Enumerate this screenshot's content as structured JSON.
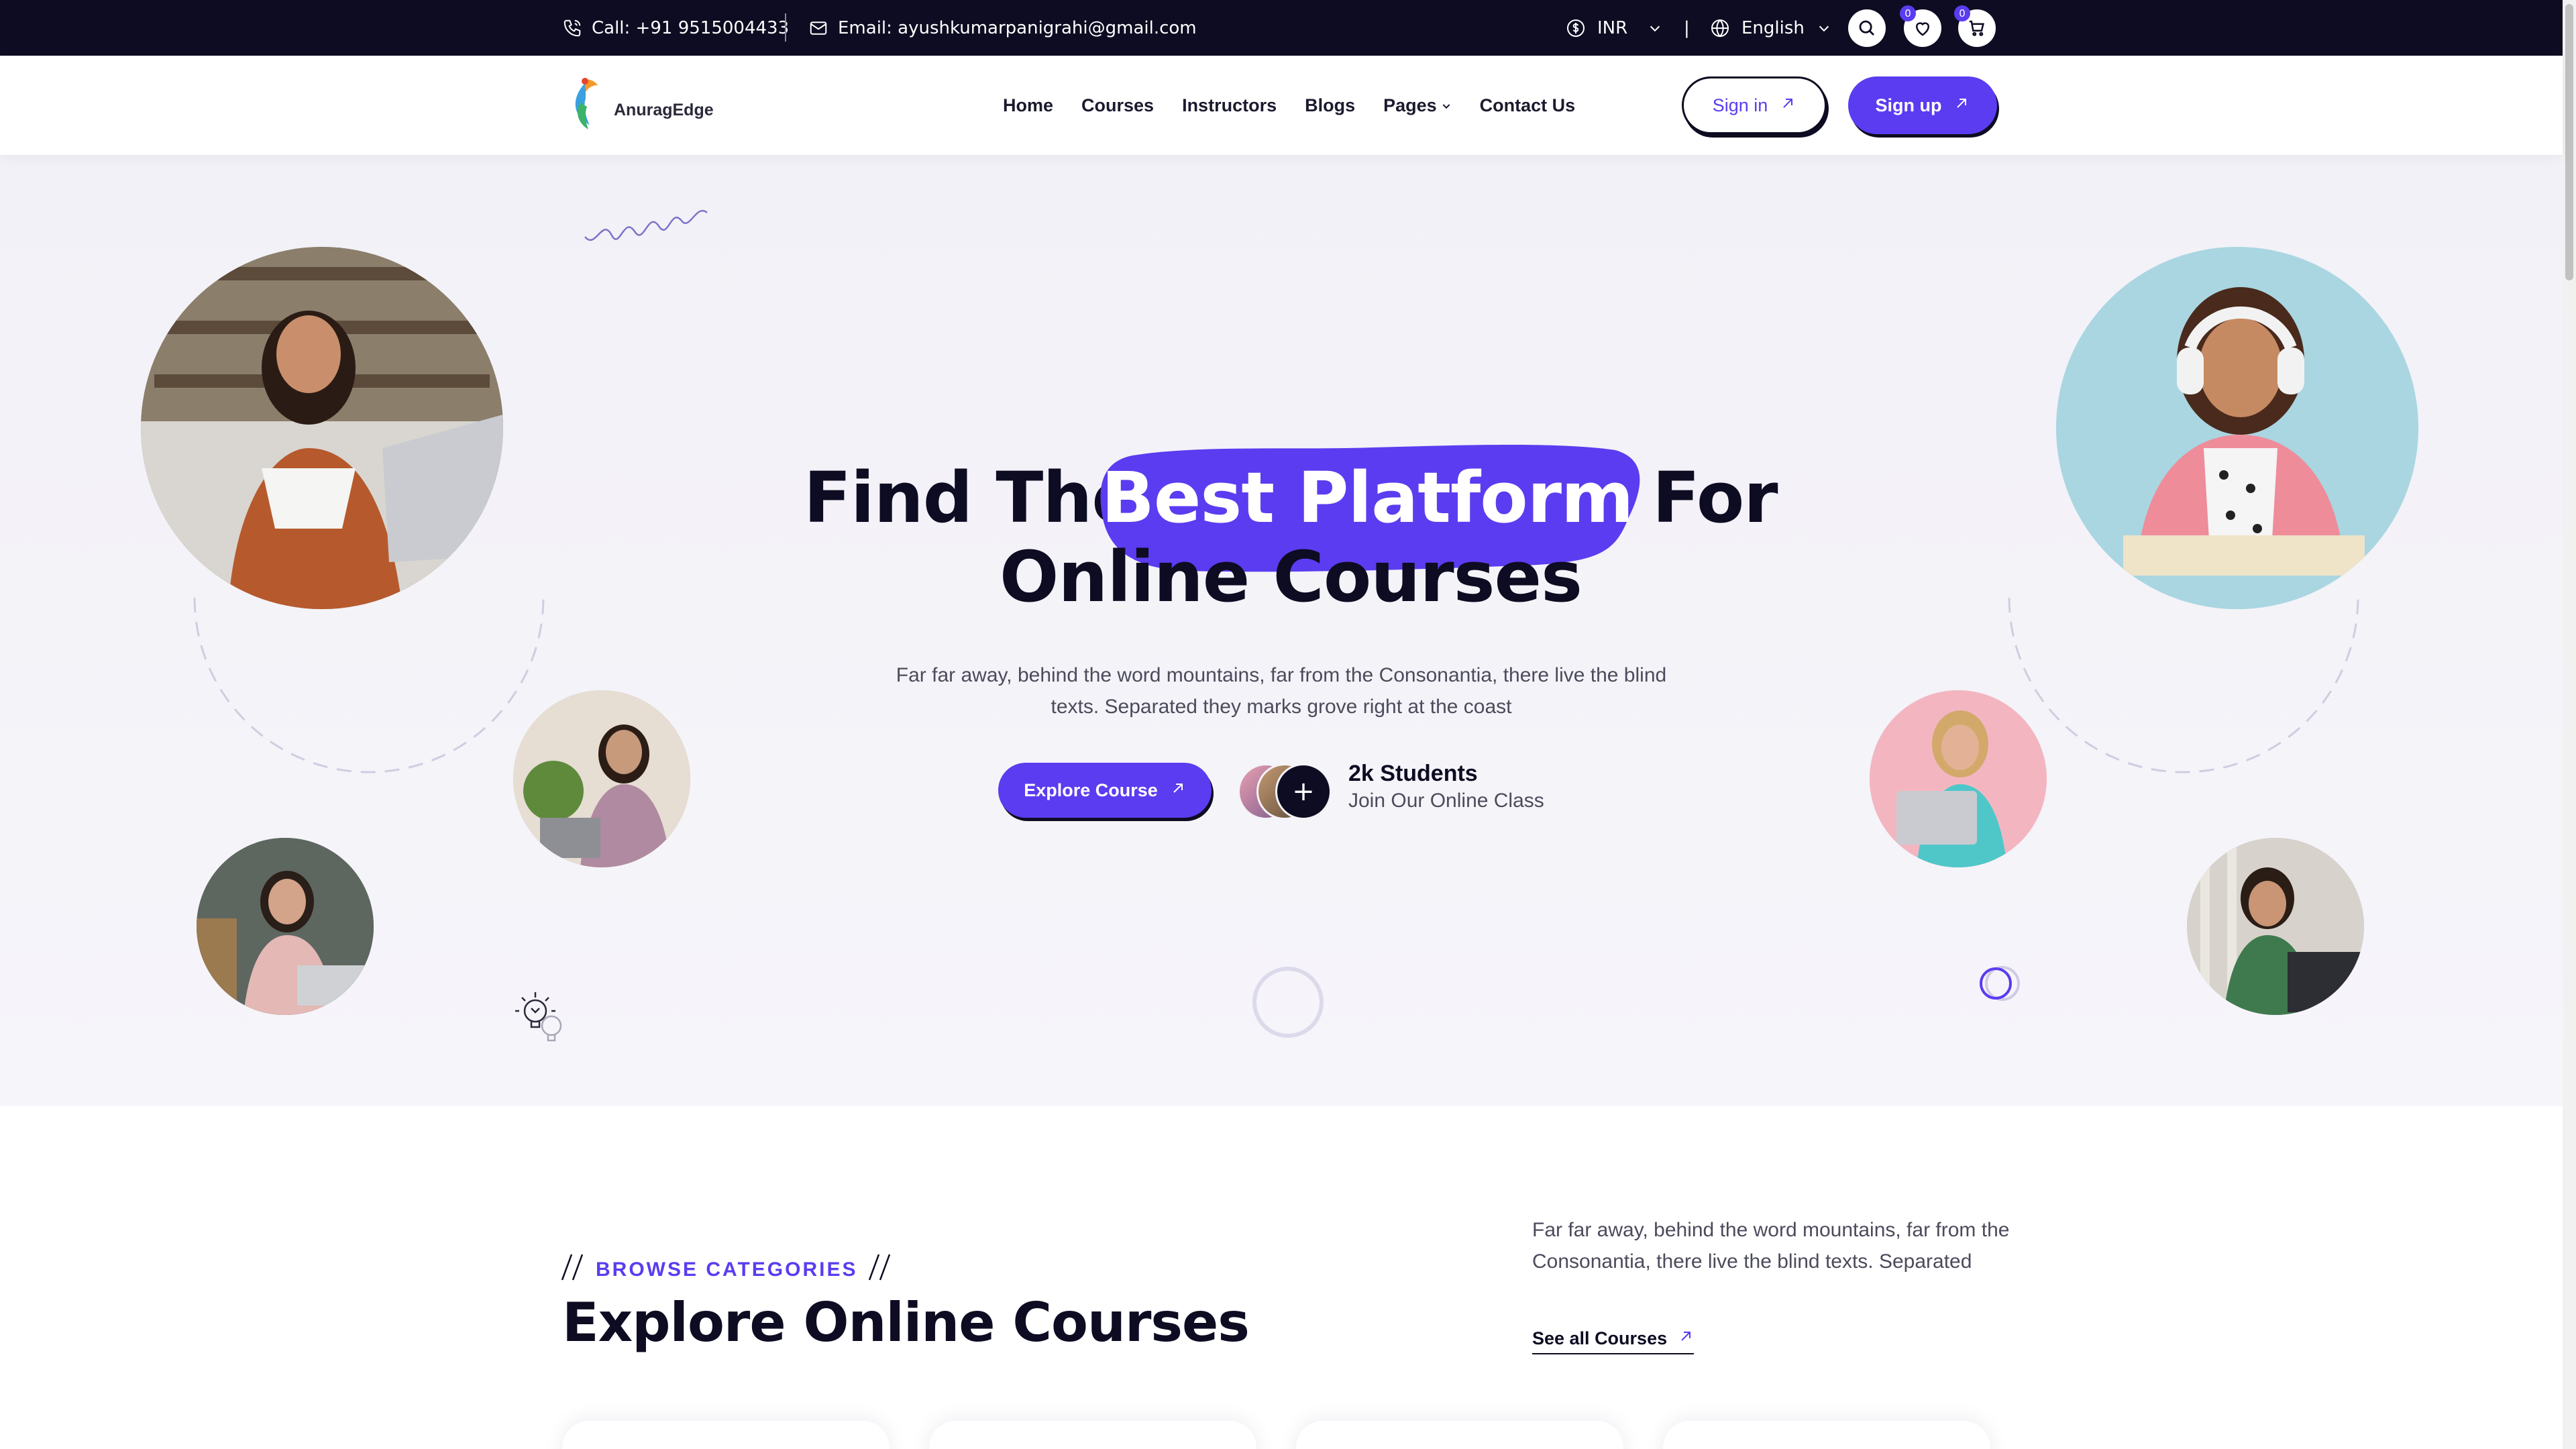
{
  "topbar": {
    "call": "Call: +91 9515004433",
    "email": "Email: ayushkumarpanigrahi@gmail.com",
    "currency": "INR",
    "separator": "|",
    "language": "English",
    "wishlist_count": "0",
    "cart_count": "0"
  },
  "header": {
    "logo_text": "AnuragEdge",
    "nav": [
      "Home",
      "Courses",
      "Instructors",
      "Blogs",
      "Pages",
      "Contact Us"
    ],
    "signin_label": "Sign in",
    "signup_label": "Sign up"
  },
  "hero": {
    "title_before": "Find The",
    "title_highlight": "Best Platform",
    "title_after": "For",
    "title_line2": "Online Courses",
    "subtitle": "Far far away, behind the word mountains, far from the Consonantia, there live the blind texts. Separated they marks grove right at the coast",
    "explore_label": "Explore Course",
    "plus_symbol": "+",
    "students_count": "2k Students",
    "students_sub": "Join Our Online Class"
  },
  "categories": {
    "eyebrow": "BROWSE CATEGORIES",
    "title": "Explore Online Courses",
    "description": "Far far away, behind the word mountains, far from the Consonantia, there live the blind texts. Separated",
    "see_all_label": "See all Courses"
  },
  "colors": {
    "primary": "#5b3cf0",
    "dark": "#0d0c22",
    "hero_bg": "#f2f1f7"
  },
  "icons": [
    "phone-icon",
    "mail-icon",
    "currency-icon",
    "globe-icon",
    "search-icon",
    "heart-icon",
    "cart-icon",
    "arrow-up-right-icon",
    "chevron-down-icon",
    "lightbulb-icon"
  ]
}
